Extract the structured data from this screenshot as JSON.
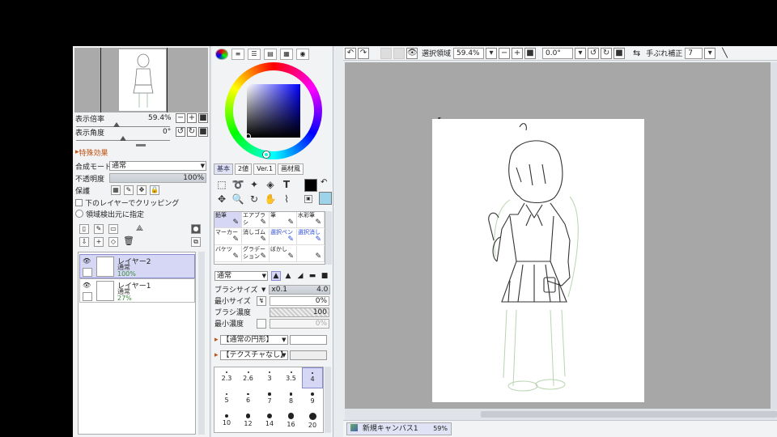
{
  "navigator": {
    "zoom_label": "表示倍率",
    "zoom_value": "59.4%",
    "angle_label": "表示角度",
    "angle_value": "0°"
  },
  "layer_panel": {
    "effects_title": "特殊効果",
    "blend_label": "合成モード",
    "blend_value": "通常",
    "opacity_label": "不透明度",
    "opacity_value": "100%",
    "protect_label": "保護",
    "clip_label": "下のレイヤーでクリッピング",
    "detect_label": "領域検出元に指定",
    "layers": [
      {
        "name": "レイヤー2",
        "mode": "通常",
        "opacity": "100%"
      },
      {
        "name": "レイヤー1",
        "mode": "通常",
        "opacity": "27%"
      }
    ]
  },
  "color_panel": {
    "tabs": [
      "基本",
      "2値",
      "Ver.1",
      "画材風"
    ],
    "primary_color": "#000000",
    "secondary_color": "#9ed4ea"
  },
  "brushes": [
    {
      "label": "鉛筆",
      "selected": true,
      "blue": false
    },
    {
      "label": "エアブラシ",
      "selected": false,
      "blue": false
    },
    {
      "label": "筆",
      "selected": false,
      "blue": false
    },
    {
      "label": "水彩筆",
      "selected": false,
      "blue": false
    },
    {
      "label": "マーカー",
      "selected": false,
      "blue": false
    },
    {
      "label": "消しゴム",
      "selected": false,
      "blue": false
    },
    {
      "label": "選択ペン",
      "selected": false,
      "blue": true
    },
    {
      "label": "選択消し",
      "selected": false,
      "blue": true
    },
    {
      "label": "バケツ",
      "selected": false,
      "blue": false
    },
    {
      "label": "グラデーション",
      "selected": false,
      "blue": false
    },
    {
      "label": "ぼかし",
      "selected": false,
      "blue": false
    },
    {
      "label": "",
      "selected": false,
      "blue": false
    }
  ],
  "brush_props": {
    "mode": "通常",
    "size_label": "ブラシサイズ",
    "size_mult": "x0.1",
    "size_value": "4.0",
    "min_size_label": "最小サイズ",
    "min_size_value": "0%",
    "density_label": "ブラシ濃度",
    "density_value": "100",
    "min_density_label": "最小濃度",
    "min_density_value": "0%",
    "shape_value": "【通常の円形】",
    "texture_value": "【テクスチャなし】"
  },
  "dot_sizes": [
    {
      "v": "2.3",
      "on": false
    },
    {
      "v": "2.6",
      "on": false
    },
    {
      "v": "3",
      "on": false
    },
    {
      "v": "3.5",
      "on": false
    },
    {
      "v": "4",
      "on": true
    },
    {
      "v": "5",
      "on": false
    },
    {
      "v": "6",
      "on": false
    },
    {
      "v": "7",
      "on": false
    },
    {
      "v": "8",
      "on": false
    },
    {
      "v": "9",
      "on": false
    },
    {
      "v": "10",
      "on": false
    },
    {
      "v": "12",
      "on": false
    },
    {
      "v": "14",
      "on": false
    },
    {
      "v": "16",
      "on": false
    },
    {
      "v": "20",
      "on": false
    }
  ],
  "toolbar": {
    "selection_label": "選択領域",
    "zoom_value": "59.4%",
    "angle_value": "0.0°",
    "stabilizer_label": "手ぶれ補正",
    "stabilizer_value": "7"
  },
  "status": {
    "document_name": "新規キャンバス1",
    "document_zoom": "59%"
  }
}
